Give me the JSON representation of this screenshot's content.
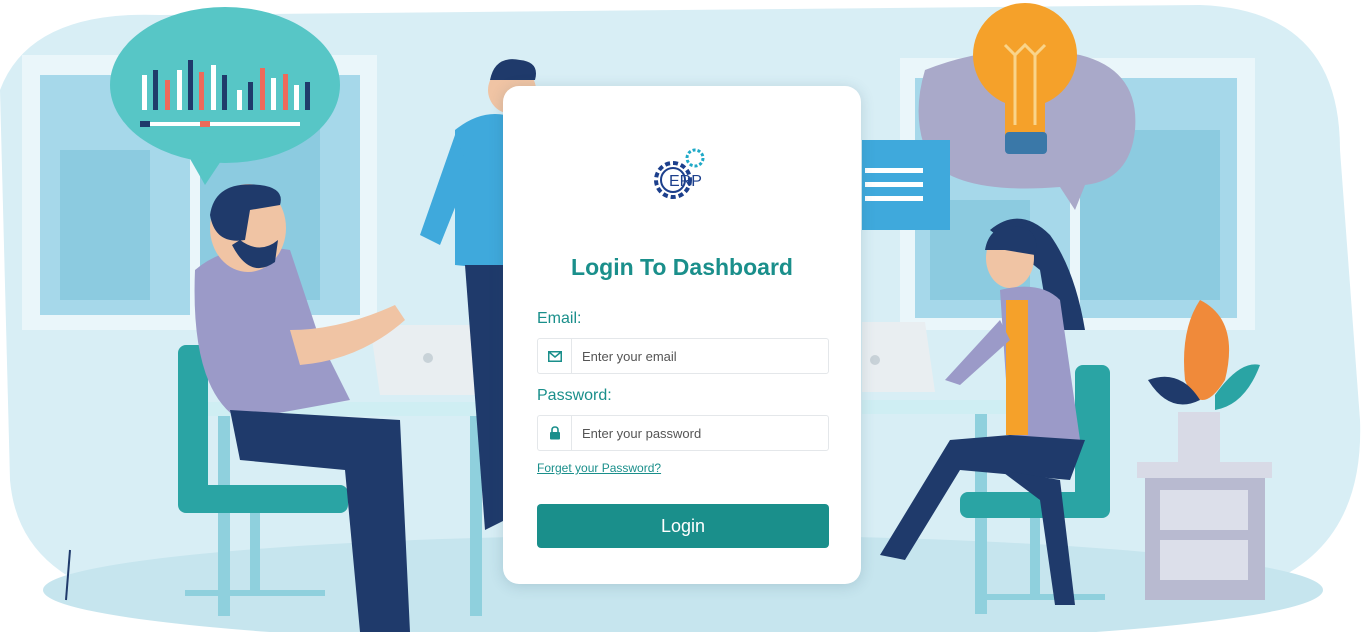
{
  "login": {
    "logo_text": "ERP",
    "title": "Login To Dashboard",
    "email_label": "Email:",
    "email_placeholder": "Enter your email",
    "email_value": "",
    "password_label": "Password:",
    "password_placeholder": "Enter your password",
    "password_value": "",
    "forgot_link": "Forget your Password?",
    "login_button": "Login"
  },
  "icons": {
    "logo": "gear-logo-icon",
    "email": "envelope-icon",
    "password": "lock-icon"
  },
  "colors": {
    "accent": "#1a8f8b",
    "background": "#d6eef5",
    "card": "#ffffff"
  }
}
